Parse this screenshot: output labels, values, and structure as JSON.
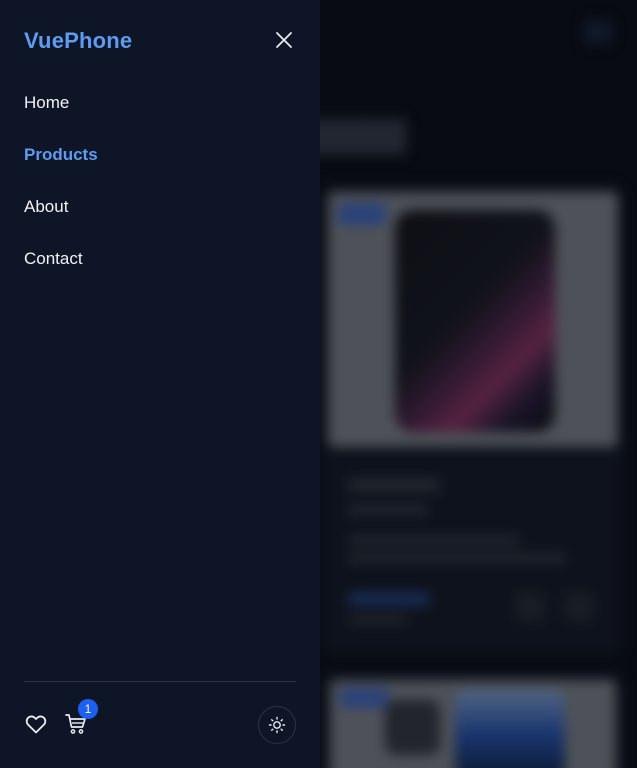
{
  "drawer": {
    "brand": "VuePhone",
    "close_icon": "close-icon",
    "nav": [
      {
        "label": "Home",
        "active": false
      },
      {
        "label": "Products",
        "active": true
      },
      {
        "label": "About",
        "active": false
      },
      {
        "label": "Contact",
        "active": false
      }
    ],
    "footer": {
      "wishlist_icon": "heart-icon",
      "cart_icon": "cart-icon",
      "cart_count": "1",
      "theme_icon": "sun-icon"
    }
  },
  "colors": {
    "accent": "#5d9cf0",
    "drawer_bg": "#0e1526",
    "badge": "#1d5ff0"
  }
}
